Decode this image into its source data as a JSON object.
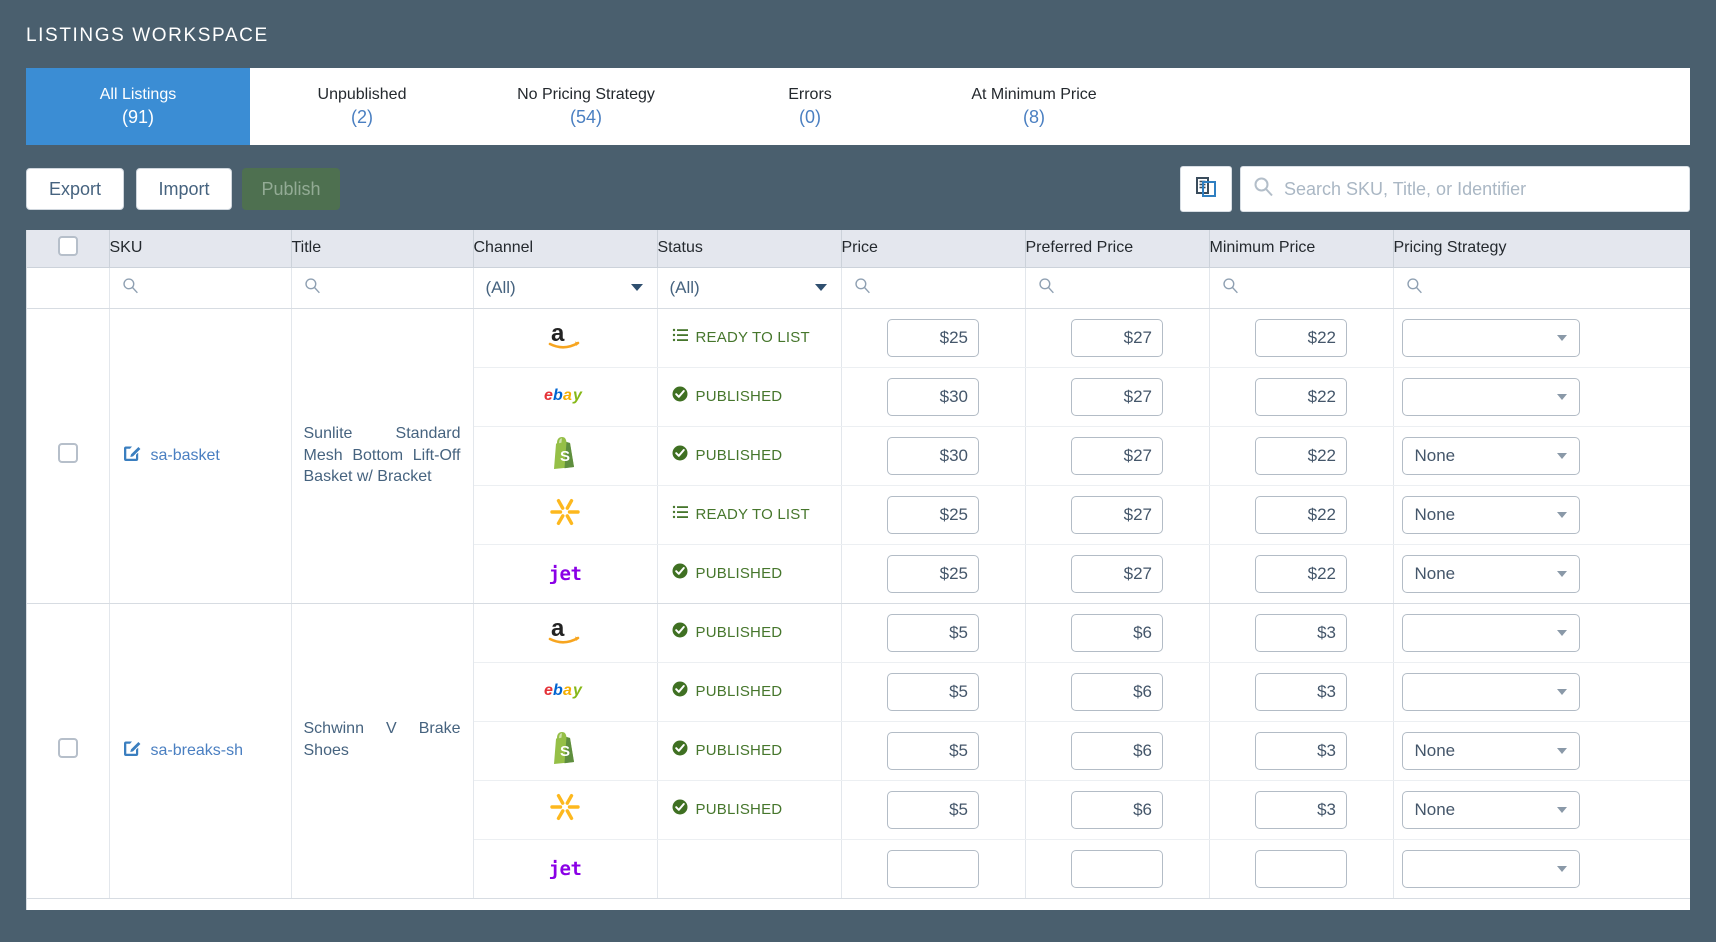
{
  "header": {
    "title": "LISTINGS WORKSPACE"
  },
  "tabs": [
    {
      "label": "All Listings",
      "count": "(91)",
      "active": true
    },
    {
      "label": "Unpublished",
      "count": "(2)",
      "active": false
    },
    {
      "label": "No Pricing Strategy",
      "count": "(54)",
      "active": false
    },
    {
      "label": "Errors",
      "count": "(0)",
      "active": false
    },
    {
      "label": "At Minimum Price",
      "count": "(8)",
      "active": false
    }
  ],
  "toolbar": {
    "export_label": "Export",
    "import_label": "Import",
    "publish_label": "Publish",
    "columns_icon": "columns-icon",
    "search_icon": "search-icon",
    "search_value": "",
    "search_placeholder": "Search SKU, Title, or Identifier"
  },
  "grid": {
    "columns": [
      "SKU",
      "Title",
      "Channel",
      "Status",
      "Price",
      "Preferred Price",
      "Minimum Price",
      "Pricing Strategy"
    ],
    "filters": {
      "sku": "",
      "title": "",
      "channel": "(All)",
      "status": "(All)",
      "price": "",
      "preferred": "",
      "minimum": "",
      "strategy": ""
    },
    "groups": [
      {
        "sku": "sa-basket",
        "title": "Sunlite Standard Mesh Bottom Lift-Off Basket w/ Bracket",
        "rows": [
          {
            "channel": "amazon",
            "status": "READY TO LIST",
            "status_icon": "list-icon",
            "price": "$25",
            "preferred": "$27",
            "minimum": "$22",
            "strategy": ""
          },
          {
            "channel": "ebay",
            "status": "PUBLISHED",
            "status_icon": "check-icon",
            "price": "$30",
            "preferred": "$27",
            "minimum": "$22",
            "strategy": ""
          },
          {
            "channel": "shopify",
            "status": "PUBLISHED",
            "status_icon": "check-icon",
            "price": "$30",
            "preferred": "$27",
            "minimum": "$22",
            "strategy": "None"
          },
          {
            "channel": "walmart",
            "status": "READY TO LIST",
            "status_icon": "list-icon",
            "price": "$25",
            "preferred": "$27",
            "minimum": "$22",
            "strategy": "None"
          },
          {
            "channel": "jet",
            "status": "PUBLISHED",
            "status_icon": "check-icon",
            "price": "$25",
            "preferred": "$27",
            "minimum": "$22",
            "strategy": "None"
          }
        ]
      },
      {
        "sku": "sa-breaks-sh",
        "title": "Schwinn V Brake Shoes",
        "rows": [
          {
            "channel": "amazon",
            "status": "PUBLISHED",
            "status_icon": "check-icon",
            "price": "$5",
            "preferred": "$6",
            "minimum": "$3",
            "strategy": ""
          },
          {
            "channel": "ebay",
            "status": "PUBLISHED",
            "status_icon": "check-icon",
            "price": "$5",
            "preferred": "$6",
            "minimum": "$3",
            "strategy": ""
          },
          {
            "channel": "shopify",
            "status": "PUBLISHED",
            "status_icon": "check-icon",
            "price": "$5",
            "preferred": "$6",
            "minimum": "$3",
            "strategy": "None"
          },
          {
            "channel": "walmart",
            "status": "PUBLISHED",
            "status_icon": "check-icon",
            "price": "$5",
            "preferred": "$6",
            "minimum": "$3",
            "strategy": "None"
          },
          {
            "channel": "jet",
            "status": "",
            "status_icon": "",
            "price": "",
            "preferred": "",
            "minimum": "",
            "strategy": ""
          }
        ]
      }
    ]
  },
  "colors": {
    "chrome": "#4a5f6e",
    "accent": "#3b8dd4",
    "link": "#4a7fc1",
    "status_green": "#46762c",
    "publish_btn": "#4e7050"
  }
}
